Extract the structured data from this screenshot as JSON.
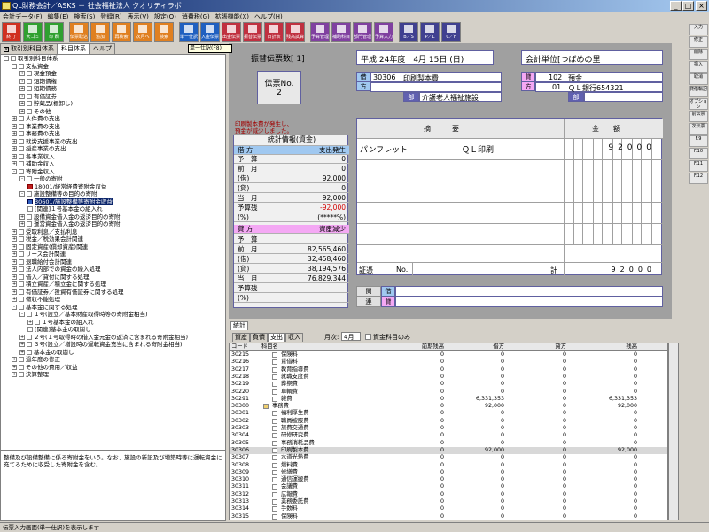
{
  "window": {
    "title": "QL財務会計／ASKS － 社会福祉法人 クオリティラボ"
  },
  "menu": [
    "会計データ(F)",
    "編集(E)",
    "検索(S)",
    "登録(R)",
    "表示(V)",
    "設定(O)",
    "消費税(G)",
    "拡張機能(X)",
    "ヘルプ(H)"
  ],
  "toolbar": [
    {
      "label": "終 了",
      "color": "#d03020"
    },
    {
      "label": "大ゴミ",
      "color": "#30a030"
    },
    {
      "label": "印 刷",
      "color": "#30a030"
    },
    {
      "label": "伝票取込",
      "color": "#e08020"
    },
    {
      "label": "追加",
      "color": "#e08020"
    },
    {
      "label": "再検索",
      "color": "#e08020"
    },
    {
      "label": "次月へ",
      "color": "#e08020"
    },
    {
      "label": "検索",
      "color": "#e08020"
    },
    {
      "label": "単一仕訳",
      "color": "#2060c0"
    },
    {
      "label": "入金伝票",
      "color": "#2060c0"
    },
    {
      "label": "出金伝票",
      "color": "#c03040"
    },
    {
      "label": "振替伝票",
      "color": "#c03040"
    },
    {
      "label": "日計表",
      "color": "#c03040"
    },
    {
      "label": "残高試算",
      "color": "#c03040"
    },
    {
      "label": "予算管理",
      "color": "#8040a0"
    },
    {
      "label": "補助科目",
      "color": "#8040a0"
    },
    {
      "label": "部門管理",
      "color": "#8040a0"
    },
    {
      "label": "予算入力",
      "color": "#8040a0"
    },
    {
      "label": "B／S",
      "color": "#404090"
    },
    {
      "label": "P／L",
      "color": "#404090"
    },
    {
      "label": "C／F",
      "color": "#404090"
    }
  ],
  "tooltip": "単一仕訳(F8)",
  "left_tabs": [
    "取引別科目体系",
    "科目体系",
    "ヘルプ"
  ],
  "tree": [
    {
      "d": 0,
      "e": "-",
      "t": "取引別科目体系",
      "i": "f"
    },
    {
      "d": 1,
      "e": "-",
      "t": "支払資金",
      "i": "f"
    },
    {
      "d": 2,
      "e": "+",
      "t": "現金預金",
      "i": "f"
    },
    {
      "d": 2,
      "e": "+",
      "t": "短期債権",
      "i": "f"
    },
    {
      "d": 2,
      "e": "+",
      "t": "短期債務",
      "i": "f"
    },
    {
      "d": 2,
      "e": "+",
      "t": "有価証券",
      "i": "f"
    },
    {
      "d": 2,
      "e": "+",
      "t": "貯蔵品(棚卸し)",
      "i": "f"
    },
    {
      "d": 2,
      "e": "+",
      "t": "その他",
      "i": "f"
    },
    {
      "d": 1,
      "e": "+",
      "t": "人件費の支出",
      "i": "f"
    },
    {
      "d": 1,
      "e": "+",
      "t": "事業費の支出",
      "i": "f"
    },
    {
      "d": 1,
      "e": "+",
      "t": "事務費の支出",
      "i": "f"
    },
    {
      "d": 1,
      "e": "+",
      "t": "就労支援事業の支出",
      "i": "f"
    },
    {
      "d": 1,
      "e": "+",
      "t": "授産事業の支出",
      "i": "f"
    },
    {
      "d": 1,
      "e": "+",
      "t": "各事業収入",
      "i": "f"
    },
    {
      "d": 1,
      "e": "+",
      "t": "補助金収入",
      "i": "f"
    },
    {
      "d": 1,
      "e": "-",
      "t": "寄附金収入",
      "i": "f"
    },
    {
      "d": 2,
      "e": "-",
      "t": "一般の寄附",
      "i": "f"
    },
    {
      "d": 3,
      "e": "",
      "t": "18001/経常経費寄附金収益",
      "i": "red"
    },
    {
      "d": 2,
      "e": "-",
      "t": "施設整備等の目的の寄附",
      "i": "f"
    },
    {
      "d": 3,
      "e": "",
      "t": "30601/施設整備等寄附金収益",
      "i": "blue",
      "sel": true
    },
    {
      "d": 3,
      "e": "",
      "t": "[関連]１号基本金の組入れ",
      "i": "f"
    },
    {
      "d": 2,
      "e": "+",
      "t": "設備資金借入金の返済目的の寄附",
      "i": "f"
    },
    {
      "d": 2,
      "e": "+",
      "t": "運営資金借入金の返済目的の寄附",
      "i": "f"
    },
    {
      "d": 1,
      "e": "+",
      "t": "受取利息／支払利息",
      "i": "f"
    },
    {
      "d": 1,
      "e": "+",
      "t": "税金／税効果会計関連",
      "i": "f"
    },
    {
      "d": 1,
      "e": "+",
      "t": "固定資産(償却資産)関連",
      "i": "f"
    },
    {
      "d": 1,
      "e": "+",
      "t": "リース会計関連",
      "i": "f"
    },
    {
      "d": 1,
      "e": "+",
      "t": "退職給付会計関連",
      "i": "f"
    },
    {
      "d": 1,
      "e": "+",
      "t": "法人内部での資金の繰入処理",
      "i": "f"
    },
    {
      "d": 1,
      "e": "+",
      "t": "借入／貸付に関する処理",
      "i": "f"
    },
    {
      "d": 1,
      "e": "+",
      "t": "積立資産／積立金に関する処理",
      "i": "f"
    },
    {
      "d": 1,
      "e": "+",
      "t": "有価証券／投資有価証券に関する処理",
      "i": "f"
    },
    {
      "d": 1,
      "e": "+",
      "t": "徴収不能処理",
      "i": "f"
    },
    {
      "d": 1,
      "e": "-",
      "t": "基本金に関する処理",
      "i": "f"
    },
    {
      "d": 2,
      "e": "-",
      "t": "１号(設立／基本財産取得時等の寄附金相当)",
      "i": "f"
    },
    {
      "d": 3,
      "e": "+",
      "t": "１号基本金の組入れ",
      "i": "f"
    },
    {
      "d": 3,
      "e": "",
      "t": "[関連]基本金の取崩し",
      "i": "f"
    },
    {
      "d": 2,
      "e": "+",
      "t": "２号(１号取得時の借入金元金の返済に含まれる寄附金相当)",
      "i": "f"
    },
    {
      "d": 2,
      "e": "+",
      "t": "３号(設立／増設時の運転資金充当に含まれる寄附金相当)",
      "i": "f"
    },
    {
      "d": 2,
      "e": "+",
      "t": "基本金の取崩し",
      "i": "f"
    },
    {
      "d": 1,
      "e": "+",
      "t": "過年度の修正",
      "i": "f"
    },
    {
      "d": 1,
      "e": "+",
      "t": "その他の費用／収益",
      "i": "f"
    },
    {
      "d": 1,
      "e": "+",
      "t": "決算整理",
      "i": "f"
    }
  ],
  "description": "整備及び設備整備に係る寄附金をいう。なお、施設の新設及び増築時等に運転資金に充てるために収受した寄附金を含む。",
  "voucher": {
    "count_label": "振替伝票数[ 1]",
    "date": "平成 24年度　4月 15日 (日)",
    "unit_label": "会計単位[つばめの里",
    "slip_label": "伝票No.",
    "slip_no": "2",
    "debit_label": "借",
    "debit_side": "方",
    "credit_label": "貸",
    "credit_side": "方",
    "debit_account": "30306",
    "debit_name": "印刷製本費",
    "debit_dept_label": "部",
    "debit_dept": "介護老人福祉施設",
    "credit_code": "102",
    "credit_name": "預金",
    "credit_sub_code": "01",
    "credit_sub": "ＱＬ銀行654321",
    "credit_dept_label": "部",
    "note1": "印刷製本費が発生し、",
    "note2": "預金が減少しました。",
    "col_summary": "摘　　　要",
    "col_amount": "金　　額",
    "line1_summary": "パンフレット",
    "line1_vendor": "ＱＬ印刷",
    "line1_amount": "92000",
    "proof_label": "証憑",
    "no_label": "No.",
    "total_label": "計",
    "total_amount": "92000",
    "related_label": "関",
    "related_label2": "連",
    "borrow_label": "借",
    "lend_label": "貸"
  },
  "stats": {
    "title": "統計情報(資金)",
    "debit_head_l": "借 方",
    "debit_head_r": "支出発生",
    "debit_rows": [
      [
        "予　算",
        "0"
      ],
      [
        "前　月",
        "0"
      ],
      [
        "(借)",
        "92,000"
      ],
      [
        "(貸)",
        "0"
      ],
      [
        "当　月",
        "92,000"
      ],
      [
        "予算残",
        "-92,000"
      ],
      [
        "(%)",
        "(*****%)"
      ]
    ],
    "credit_head_l": "貸 方",
    "credit_head_r": "資産減少",
    "credit_rows": [
      [
        "予　算",
        ""
      ],
      [
        "前　月",
        "82,565,460"
      ],
      [
        "(借)",
        "32,458,460"
      ],
      [
        "(貸)",
        "38,194,576"
      ],
      [
        "当　月",
        "76,829,344"
      ],
      [
        "予算残",
        ""
      ],
      [
        "(%)",
        ""
      ]
    ]
  },
  "right_buttons": [
    "入力",
    "修正",
    "削除",
    "挿入",
    "取消",
    "貸借転記",
    "オプション",
    "前伝票",
    "次伝票",
    "F.9",
    "F.10",
    "F.11",
    "F.12"
  ],
  "lower": {
    "tab_label": "統計",
    "sub_tabs": [
      "資産",
      "負債",
      "支出",
      "収入"
    ],
    "month_label": "月次:",
    "month_value": "4月",
    "check_label": "資金科目のみ",
    "headers": [
      "コード",
      "科目名",
      "前期残高",
      "借方",
      "貸方",
      "残高"
    ],
    "rows": [
      [
        "30215",
        "",
        "保険料",
        "0",
        "0",
        "0",
        "0"
      ],
      [
        "30216",
        "",
        "賃借料",
        "0",
        "0",
        "0",
        "0"
      ],
      [
        "30217",
        "",
        "教育指導費",
        "0",
        "0",
        "0",
        "0"
      ],
      [
        "30218",
        "",
        "就職支度費",
        "0",
        "0",
        "0",
        "0"
      ],
      [
        "30219",
        "",
        "葬祭費",
        "0",
        "0",
        "0",
        "0"
      ],
      [
        "30220",
        "",
        "車輌費",
        "0",
        "0",
        "0",
        "0"
      ],
      [
        "30291",
        "",
        "雑費",
        "0",
        "6,331,353",
        "0",
        "6,331,353"
      ],
      [
        "30300",
        "f",
        "事務費",
        "0",
        "92,000",
        "0",
        "92,000"
      ],
      [
        "30301",
        "",
        "福利厚生費",
        "0",
        "0",
        "0",
        "0"
      ],
      [
        "30302",
        "",
        "職員被服費",
        "0",
        "0",
        "0",
        "0"
      ],
      [
        "30303",
        "",
        "旅費交通費",
        "0",
        "0",
        "0",
        "0"
      ],
      [
        "30304",
        "",
        "研修研究費",
        "0",
        "0",
        "0",
        "0"
      ],
      [
        "30305",
        "",
        "事務消耗品費",
        "0",
        "0",
        "0",
        "0"
      ],
      [
        "30306",
        "",
        "印刷製本費",
        "0",
        "92,000",
        "0",
        "92,000"
      ],
      [
        "30307",
        "",
        "水道光熱費",
        "0",
        "0",
        "0",
        "0"
      ],
      [
        "30308",
        "",
        "燃料費",
        "0",
        "0",
        "0",
        "0"
      ],
      [
        "30309",
        "",
        "修繕費",
        "0",
        "0",
        "0",
        "0"
      ],
      [
        "30310",
        "",
        "通信運搬費",
        "0",
        "0",
        "0",
        "0"
      ],
      [
        "30311",
        "",
        "会議費",
        "0",
        "0",
        "0",
        "0"
      ],
      [
        "30312",
        "",
        "広報費",
        "0",
        "0",
        "0",
        "0"
      ],
      [
        "30313",
        "",
        "業務委託費",
        "0",
        "0",
        "0",
        "0"
      ],
      [
        "30314",
        "",
        "手数料",
        "0",
        "0",
        "0",
        "0"
      ],
      [
        "30315",
        "",
        "保険料",
        "0",
        "0",
        "0",
        "0"
      ]
    ]
  },
  "status": "伝票入力画面(単一仕訳)を表示します"
}
